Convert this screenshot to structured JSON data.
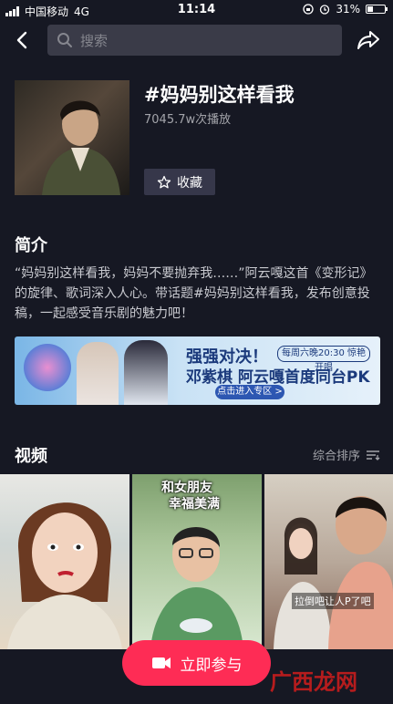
{
  "status_bar": {
    "carrier": "中国移动",
    "network": "4G",
    "time": "11:14",
    "battery": "31%",
    "battery_level": 0.31
  },
  "search": {
    "placeholder": "搜索"
  },
  "topic": {
    "title": "#妈妈别这样看我",
    "play_count": "7045.7w次播放",
    "favorite_label": "收藏"
  },
  "intro": {
    "heading": "简介",
    "text": "“妈妈别这样看我，妈妈不要抛弃我……”阿云嘎这首《变形记》的旋律、歌词深入人心。带话题#妈妈别这样看我，发布创意投稿，一起感受音乐剧的魅力吧！"
  },
  "banner": {
    "title1": "强强对决！",
    "badge": "每周六晚20:30 惊艳开唱",
    "title2": "邓紫棋 阿云嘎首度同台PK",
    "button": "点击进入专区 >"
  },
  "videos": {
    "heading": "视频",
    "sort_label": "综合排序",
    "items": [
      {
        "caption": ""
      },
      {
        "caption_line1": "和女朋友",
        "caption_line2": "幸福美满"
      },
      {
        "caption": "拉倒吧让人P了吧"
      }
    ]
  },
  "join_button": {
    "label": "立即参与"
  },
  "watermark": "广西龙网",
  "colors": {
    "background": "#161823",
    "accent": "#fe2c55",
    "search_bg": "#3a3b48"
  }
}
